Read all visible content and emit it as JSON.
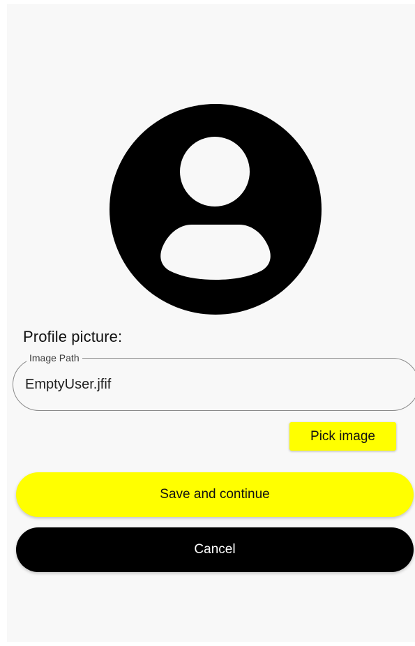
{
  "profile": {
    "avatar_icon": "person-avatar-icon",
    "section_label": "Profile picture:"
  },
  "image_path_field": {
    "label": "Image Path",
    "value": "EmptyUser.jfif"
  },
  "actions": {
    "pick_image_label": "Pick image",
    "save_label": "Save and continue",
    "cancel_label": "Cancel"
  },
  "colors": {
    "accent": "#ffff00",
    "dark": "#000000",
    "background": "#f8f8f8"
  }
}
